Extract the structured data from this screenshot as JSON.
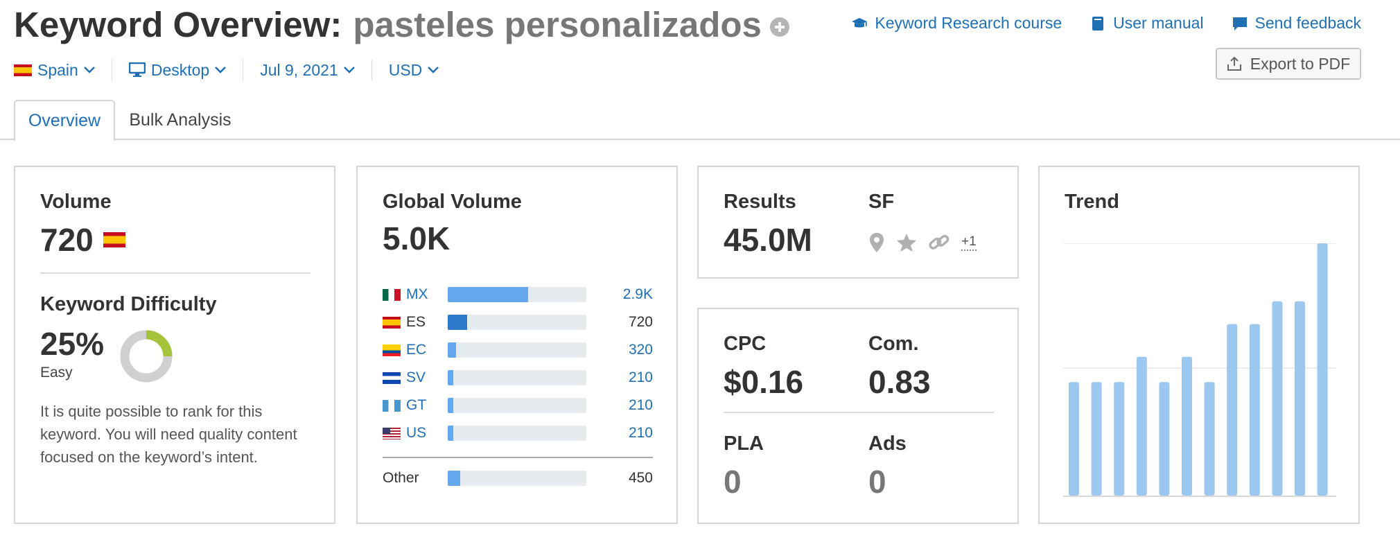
{
  "header": {
    "title_label": "Keyword Overview:",
    "keyword": "pasteles personalizados",
    "links": [
      {
        "label": "Keyword Research course",
        "icon": "graduation-cap-icon"
      },
      {
        "label": "User manual",
        "icon": "book-icon"
      },
      {
        "label": "Send feedback",
        "icon": "speech-bubble-icon"
      }
    ],
    "export_label": "Export to PDF"
  },
  "filters": {
    "country": "Spain",
    "device": "Desktop",
    "date": "Jul 9, 2021",
    "currency": "USD"
  },
  "tabs": [
    {
      "label": "Overview",
      "active": true
    },
    {
      "label": "Bulk Analysis",
      "active": false
    }
  ],
  "volume": {
    "title": "Volume",
    "value": "720",
    "kd_title": "Keyword Difficulty",
    "kd_value": "25%",
    "kd_label": "Easy",
    "kd_percent": 25,
    "kd_description": "It is quite possible to rank for this keyword. You will need quality content focused on the keyword’s intent."
  },
  "global_volume": {
    "title": "Global Volume",
    "value": "5.0K",
    "rows": [
      {
        "code": "MX",
        "value": "2.9K",
        "fill": 0.58,
        "link": true
      },
      {
        "code": "ES",
        "value": "720",
        "fill": 0.14,
        "link": false
      },
      {
        "code": "EC",
        "value": "320",
        "fill": 0.06,
        "link": true
      },
      {
        "code": "SV",
        "value": "210",
        "fill": 0.04,
        "link": true
      },
      {
        "code": "GT",
        "value": "210",
        "fill": 0.04,
        "link": true
      },
      {
        "code": "US",
        "value": "210",
        "fill": 0.04,
        "link": true
      }
    ],
    "other": {
      "label": "Other",
      "value": "450",
      "fill": 0.09
    }
  },
  "results": {
    "results_label": "Results",
    "results_value": "45.0M",
    "sf_label": "SF",
    "sf_more": "+1"
  },
  "cpc": {
    "cpc_label": "CPC",
    "cpc_value": "$0.16",
    "com_label": "Com.",
    "com_value": "0.83",
    "pla_label": "PLA",
    "pla_value": "0",
    "ads_label": "Ads",
    "ads_value": "0"
  },
  "trend": {
    "title": "Trend",
    "bar_color": "#9cc8ef",
    "values": [
      0.45,
      0.45,
      0.45,
      0.55,
      0.45,
      0.55,
      0.45,
      0.68,
      0.68,
      0.77,
      0.77,
      1.0
    ]
  },
  "colors": {
    "accent": "#1f6fb5",
    "kd_green": "#a4c23a",
    "bar_light": "#63a8ec",
    "bar_dark": "#2d78c8"
  }
}
